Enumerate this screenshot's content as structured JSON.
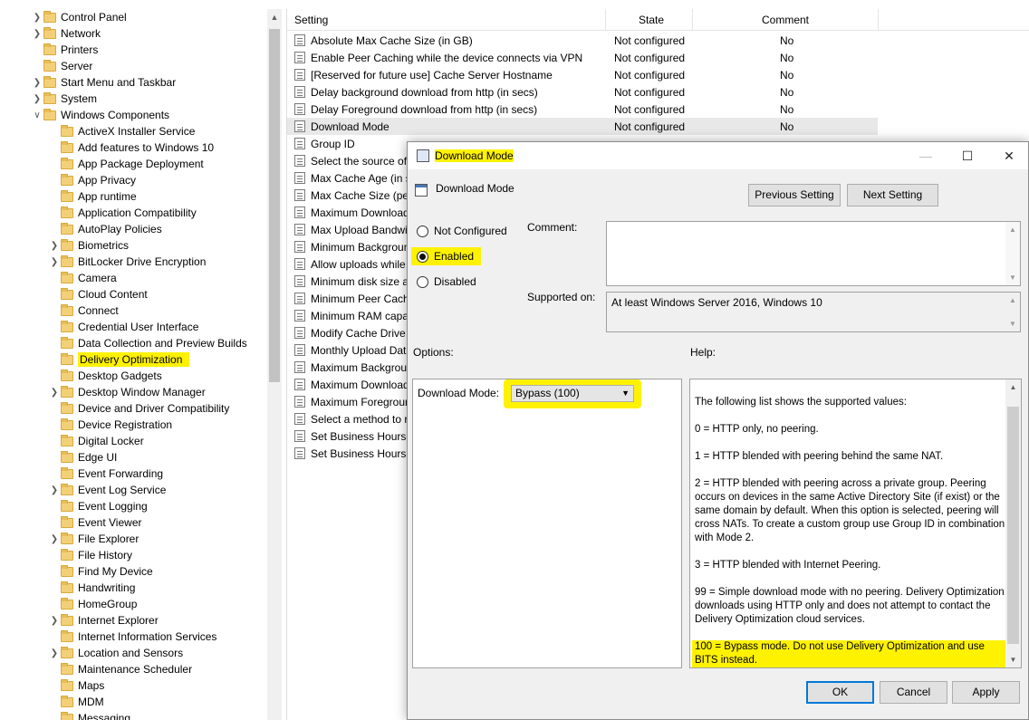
{
  "tree": {
    "items": [
      {
        "label": "Control Panel",
        "expander": "collapsed"
      },
      {
        "label": "Network",
        "expander": "collapsed"
      },
      {
        "label": "Printers",
        "expander": "none"
      },
      {
        "label": "Server",
        "expander": "none"
      },
      {
        "label": "Start Menu and Taskbar",
        "expander": "collapsed"
      },
      {
        "label": "System",
        "expander": "collapsed"
      },
      {
        "label": "Windows Components",
        "expander": "expanded"
      }
    ],
    "components": [
      {
        "label": "ActiveX Installer Service",
        "expander": "none"
      },
      {
        "label": "Add features to Windows 10",
        "expander": "none"
      },
      {
        "label": "App Package Deployment",
        "expander": "none"
      },
      {
        "label": "App Privacy",
        "expander": "none"
      },
      {
        "label": "App runtime",
        "expander": "none"
      },
      {
        "label": "Application Compatibility",
        "expander": "none"
      },
      {
        "label": "AutoPlay Policies",
        "expander": "none"
      },
      {
        "label": "Biometrics",
        "expander": "collapsed"
      },
      {
        "label": "BitLocker Drive Encryption",
        "expander": "collapsed"
      },
      {
        "label": "Camera",
        "expander": "none"
      },
      {
        "label": "Cloud Content",
        "expander": "none"
      },
      {
        "label": "Connect",
        "expander": "none"
      },
      {
        "label": "Credential User Interface",
        "expander": "none"
      },
      {
        "label": "Data Collection and Preview Builds",
        "expander": "none"
      },
      {
        "label": "Delivery Optimization",
        "expander": "none",
        "selected": true
      },
      {
        "label": "Desktop Gadgets",
        "expander": "none"
      },
      {
        "label": "Desktop Window Manager",
        "expander": "collapsed"
      },
      {
        "label": "Device and Driver Compatibility",
        "expander": "none"
      },
      {
        "label": "Device Registration",
        "expander": "none"
      },
      {
        "label": "Digital Locker",
        "expander": "none"
      },
      {
        "label": "Edge UI",
        "expander": "none"
      },
      {
        "label": "Event Forwarding",
        "expander": "none"
      },
      {
        "label": "Event Log Service",
        "expander": "collapsed"
      },
      {
        "label": "Event Logging",
        "expander": "none"
      },
      {
        "label": "Event Viewer",
        "expander": "none"
      },
      {
        "label": "File Explorer",
        "expander": "collapsed"
      },
      {
        "label": "File History",
        "expander": "none"
      },
      {
        "label": "Find My Device",
        "expander": "none"
      },
      {
        "label": "Handwriting",
        "expander": "none"
      },
      {
        "label": "HomeGroup",
        "expander": "none"
      },
      {
        "label": "Internet Explorer",
        "expander": "collapsed"
      },
      {
        "label": "Internet Information Services",
        "expander": "none"
      },
      {
        "label": "Location and Sensors",
        "expander": "collapsed"
      },
      {
        "label": "Maintenance Scheduler",
        "expander": "none"
      },
      {
        "label": "Maps",
        "expander": "none"
      },
      {
        "label": "MDM",
        "expander": "none"
      },
      {
        "label": "Messaging",
        "expander": "none"
      }
    ]
  },
  "list": {
    "col_setting": "Setting",
    "col_state": "State",
    "col_comment": "Comment",
    "rows": [
      {
        "name": "Absolute Max Cache Size (in GB)",
        "state": "Not configured",
        "comment": "No"
      },
      {
        "name": "Enable Peer Caching while the device connects via VPN",
        "state": "Not configured",
        "comment": "No"
      },
      {
        "name": "[Reserved for future use] Cache Server Hostname",
        "state": "Not configured",
        "comment": "No"
      },
      {
        "name": "Delay background download from http (in secs)",
        "state": "Not configured",
        "comment": "No"
      },
      {
        "name": "Delay Foreground download from http (in secs)",
        "state": "Not configured",
        "comment": "No"
      },
      {
        "name": "Download Mode",
        "state": "Not configured",
        "comment": "No",
        "selected": true
      },
      {
        "name": "Group ID",
        "state": "",
        "comment": ""
      },
      {
        "name": "Select the source of G",
        "state": "",
        "comment": ""
      },
      {
        "name": "Max Cache Age (in se",
        "state": "",
        "comment": ""
      },
      {
        "name": "Max Cache Size (perce",
        "state": "",
        "comment": ""
      },
      {
        "name": "Maximum Download",
        "state": "",
        "comment": ""
      },
      {
        "name": "Max Upload Bandwid",
        "state": "",
        "comment": ""
      },
      {
        "name": "Minimum Backgroun",
        "state": "",
        "comment": ""
      },
      {
        "name": "Allow uploads while",
        "state": "",
        "comment": ""
      },
      {
        "name": "Minimum disk size al",
        "state": "",
        "comment": ""
      },
      {
        "name": "Minimum Peer Cachi",
        "state": "",
        "comment": ""
      },
      {
        "name": "Minimum RAM capa",
        "state": "",
        "comment": ""
      },
      {
        "name": "Modify Cache Drive",
        "state": "",
        "comment": ""
      },
      {
        "name": "Monthly Upload Data",
        "state": "",
        "comment": ""
      },
      {
        "name": "Maximum Backgroun",
        "state": "",
        "comment": ""
      },
      {
        "name": "Maximum Download",
        "state": "",
        "comment": ""
      },
      {
        "name": "Maximum Foregroun",
        "state": "",
        "comment": ""
      },
      {
        "name": "Select a method to re",
        "state": "",
        "comment": ""
      },
      {
        "name": "Set Business Hours to",
        "state": "",
        "comment": ""
      },
      {
        "name": "Set Business Hours to",
        "state": "",
        "comment": ""
      }
    ]
  },
  "dialog": {
    "title": "Download Mode",
    "setting_name": "Download Mode",
    "previous_button": "Previous Setting",
    "next_button": "Next Setting",
    "radio_not_configured": "Not Configured",
    "radio_enabled": "Enabled",
    "radio_disabled": "Disabled",
    "selected_radio": "Enabled",
    "comment_label": "Comment:",
    "comment_value": "",
    "supported_label": "Supported on:",
    "supported_value": "At least Windows Server 2016, Windows 10",
    "options_label": "Options:",
    "help_label": "Help:",
    "download_mode_label": "Download Mode:",
    "download_mode_value": "Bypass (100)",
    "help_paragraphs": [
      "The following list shows the supported values:",
      "0 = HTTP only, no peering.",
      "1 = HTTP blended with peering behind the same NAT.",
      "2 = HTTP blended with peering across a private group. Peering occurs on devices in the same Active Directory Site (if exist) or the same domain by default. When this option is selected, peering will cross NATs. To create a custom group use Group ID in combination with Mode 2.",
      "3 = HTTP blended with Internet Peering.",
      "99 = Simple download mode with no peering. Delivery Optimization downloads using HTTP only and does not attempt to contact the Delivery Optimization cloud services.",
      "100 = Bypass mode. Do not use Delivery Optimization and use BITS instead."
    ],
    "ok_button": "OK",
    "cancel_button": "Cancel",
    "apply_button": "Apply"
  },
  "colors": {
    "highlight": "#fff200",
    "default_button_border": "#0078d7"
  }
}
